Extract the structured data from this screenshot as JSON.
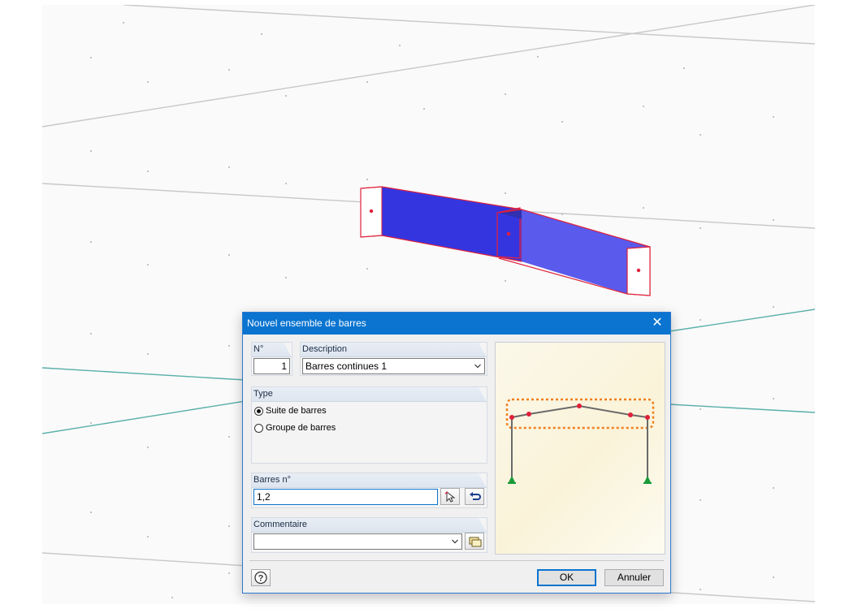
{
  "dialog": {
    "title": "Nouvel ensemble de barres",
    "close_glyph": "✕",
    "number": {
      "label": "N°",
      "value": "1"
    },
    "description": {
      "label": "Description",
      "value": "Barres continues 1"
    },
    "type": {
      "label": "Type",
      "options": [
        {
          "label": "Suite de barres",
          "checked": true
        },
        {
          "label": "Groupe de barres",
          "checked": false
        }
      ]
    },
    "members": {
      "label": "Barres n°",
      "value": "1,2"
    },
    "comment": {
      "label": "Commentaire",
      "value": ""
    },
    "buttons": {
      "ok": "OK",
      "cancel": "Annuler"
    }
  },
  "icons": {
    "close": "close-icon",
    "combo": "chevron-down-icon",
    "pick": "pick-cursor-icon",
    "reverse": "reverse-arrow-icon",
    "comment_library": "comment-library-icon",
    "help": "help-icon"
  },
  "colors": {
    "title_bar": "#0a74d0",
    "beam": "#3b3bdc",
    "selection": "#e0203a",
    "preview_highlight": "#f07f1f",
    "support": "#1a9a3a"
  }
}
